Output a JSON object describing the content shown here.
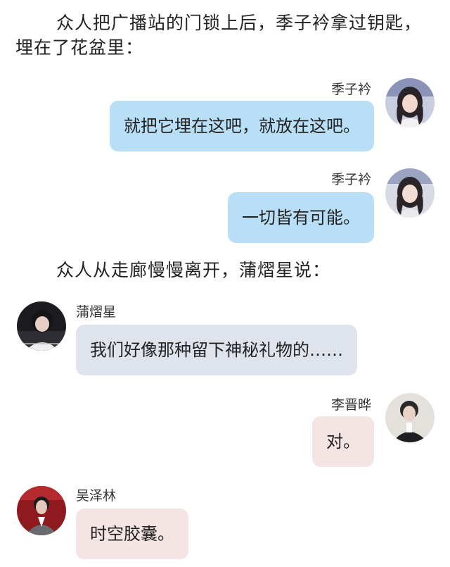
{
  "narration": [
    "众人把广播站的门锁上后，季子衿拿过钥匙，埋在了花盆里：",
    "众人从走廊慢慢离开，蒲熠星说："
  ],
  "messages": [
    {
      "sender": "季子衿",
      "text": "就把它埋在这吧，就放在这吧。"
    },
    {
      "sender": "季子衿",
      "text": "一切皆有可能。"
    },
    {
      "sender": "蒲熠星",
      "text": "我们好像那种留下神秘礼物的……"
    },
    {
      "sender": "李晋晔",
      "text": "对。"
    },
    {
      "sender": "吴泽林",
      "text": "时空胶囊。"
    }
  ],
  "colors": {
    "right_bubble_blue": "#b9dff7",
    "left_bubble_grey": "#dfe3ec",
    "bubble_pink": "#f4e4e4"
  }
}
